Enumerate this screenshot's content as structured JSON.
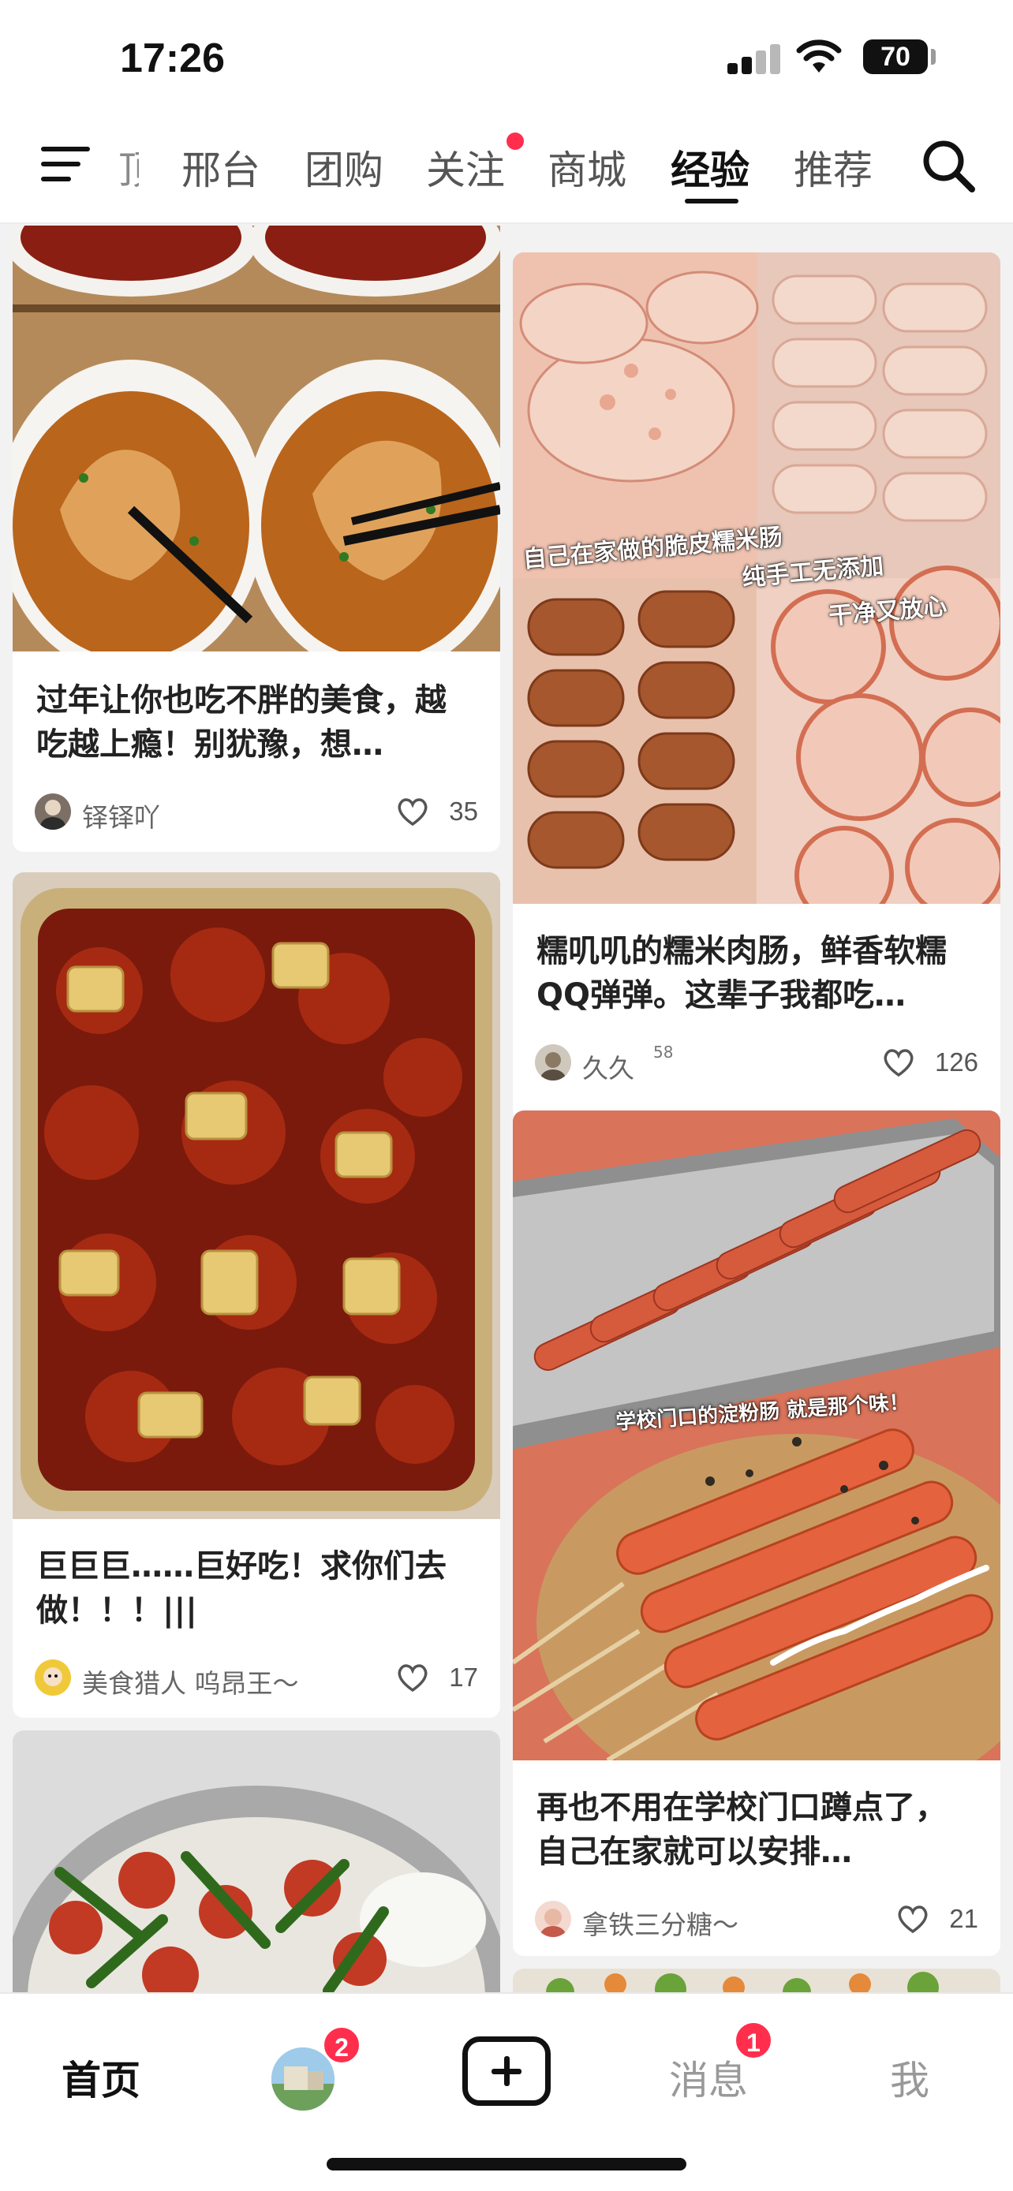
{
  "status_bar": {
    "time": "17:26",
    "battery": "70"
  },
  "top_nav": {
    "cut_tab": "顶",
    "tabs": [
      {
        "label": "邢台"
      },
      {
        "label": "团购"
      },
      {
        "label": "关注"
      },
      {
        "label": "商城"
      },
      {
        "label": "经验"
      },
      {
        "label": "推荐"
      }
    ],
    "active_tab": "经验"
  },
  "feed": {
    "left": [
      {
        "title": "过年让你也吃不胖的美食，越吃越上瘾！别犹豫，想…",
        "author": "铎铎吖",
        "likes": "35"
      },
      {
        "title": "巨巨巨……巨好吃！求你们去做！！！|||",
        "author": "美食猎人 呜昂王～",
        "likes": "17"
      },
      {
        "title": "",
        "author": "",
        "likes": ""
      }
    ],
    "right": [
      {
        "title": "糯叽叽的糯米肉肠，鲜香软糯QQ弹弹。这辈子我都吃…",
        "author": "久久",
        "author_badge": "58",
        "likes": "126",
        "overlay": [
          "自己在家做的脆皮糯米肠",
          "纯手工无添加",
          "干净又放心"
        ]
      },
      {
        "title": "再也不用在学校门口蹲点了，自己在家就可以安排…",
        "author": "拿铁三分糖～",
        "likes": "21",
        "overlay": [
          "学校门口的淀粉肠 就是那个味！"
        ]
      }
    ]
  },
  "bottom_bar": {
    "home": "首页",
    "friend_badge": "2",
    "messages": "消息",
    "messages_badge": "1",
    "me": "我"
  },
  "colors": {
    "accent_red": "#ff2e4d",
    "text_dark": "#111111",
    "background": "#f2f2f2"
  }
}
